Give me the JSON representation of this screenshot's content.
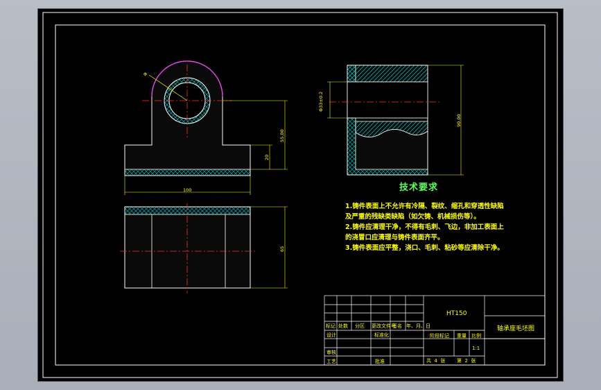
{
  "technical_requirements": {
    "title": "技术要求",
    "lines": [
      "1.铸件表面上不允许有冷隔、裂纹、缩孔和穿透性缺陷",
      "及严重的残缺类缺陷（如欠铸、机械损伤等）。",
      "2.铸件应清理干净，不得有毛刺、飞边，非加工表面上",
      "的浇冒口应清理与铸件表面齐平。",
      "3.铸件表面应平整，浇口、毛刺、粘砂等应清除干净。"
    ]
  },
  "title_block": {
    "material": "HT150",
    "part_name": "轴承座毛坯图",
    "scale": "1:1",
    "labels": {
      "mark": "标记",
      "count": "处数",
      "zone": "分区",
      "change_doc": "更改文件号",
      "sign": "签名",
      "date": "年、月、日",
      "design": "设计",
      "standardize": "标准化",
      "stage_mark": "阶段标记",
      "weight": "重量",
      "ratio": "比例",
      "review": "审核",
      "process": "工艺",
      "approve": "批准",
      "total_sheets": "共",
      "sheet_no": "第",
      "sheets_unit": "张",
      "total_count": "4",
      "sheet_index": "2"
    }
  },
  "dimensions": {
    "diameter": "Φ",
    "height_axis": "55.00",
    "height_base": "20",
    "width": "100",
    "depth": "65",
    "side_bore": "Φ33±0.2",
    "side_height": "90.00"
  }
}
